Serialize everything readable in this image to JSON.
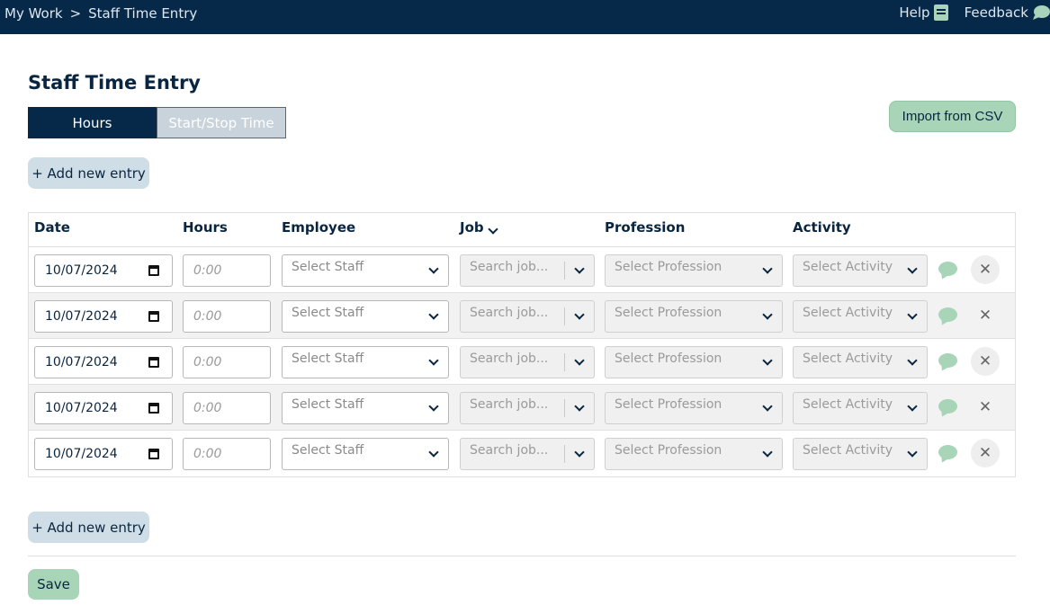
{
  "topbar": {
    "breadcrumb": [
      "My Work",
      "Staff Time Entry"
    ],
    "separator": ">",
    "help_label": "Help",
    "feedback_label": "Feedback"
  },
  "page": {
    "title": "Staff Time Entry",
    "mode_tabs": [
      "Hours",
      "Start/Stop Time"
    ],
    "active_mode": "Hours",
    "import_label": "Import from CSV",
    "add_entry_label": "+ Add new entry",
    "save_label": "Save"
  },
  "table": {
    "headers": [
      "Date",
      "Hours",
      "Employee",
      "Job",
      "Profession",
      "Activity"
    ],
    "rows": [
      {
        "date": "10/07/2024",
        "hours_placeholder": "0:00",
        "staff": "Select Staff",
        "job": "Search job...",
        "profession": "Select Profession",
        "activity": "Select Activity"
      },
      {
        "date": "10/07/2024",
        "hours_placeholder": "0:00",
        "staff": "Select Staff",
        "job": "Search job...",
        "profession": "Select Profession",
        "activity": "Select Activity"
      },
      {
        "date": "10/07/2024",
        "hours_placeholder": "0:00",
        "staff": "Select Staff",
        "job": "Search job...",
        "profession": "Select Profession",
        "activity": "Select Activity"
      },
      {
        "date": "10/07/2024",
        "hours_placeholder": "0:00",
        "staff": "Select Staff",
        "job": "Search job...",
        "profession": "Select Profession",
        "activity": "Select Activity"
      },
      {
        "date": "10/07/2024",
        "hours_placeholder": "0:00",
        "staff": "Select Staff",
        "job": "Search job...",
        "profession": "Select Profession",
        "activity": "Select Activity"
      }
    ],
    "remove_symbol": "✕"
  },
  "colors": {
    "nav_bg": "#06294a",
    "accent_green": "#a8d5b8",
    "secondary_btn": "#cfdde6"
  }
}
